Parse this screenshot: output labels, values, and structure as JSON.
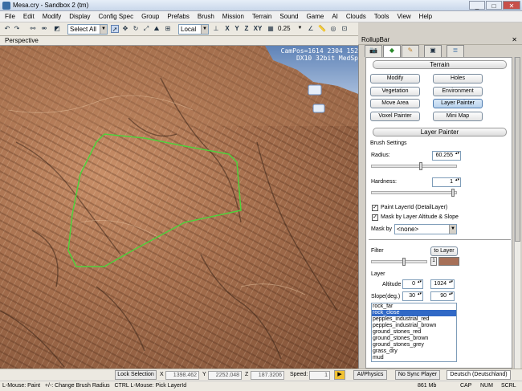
{
  "window": {
    "title": "Mesa.cry - Sandbox 2 (tm)",
    "controls": [
      "_",
      "□",
      "✕"
    ]
  },
  "menu": [
    "File",
    "Edit",
    "Modify",
    "Display",
    "Config Spec",
    "Group",
    "Prefabs",
    "Brush",
    "Mission",
    "Terrain",
    "Sound",
    "Game",
    "AI",
    "Clouds",
    "Tools",
    "View",
    "Help"
  ],
  "toolbar": {
    "selection": "Select All",
    "coord_system": "Local",
    "axes": [
      "X",
      "Y",
      "Z",
      "XY"
    ],
    "snap_value": "0.25"
  },
  "viewport": {
    "label": "Perspective",
    "cam_info": [
      "CamPos=1614 2304 152",
      "DX10 32bit MedSp"
    ]
  },
  "rollup": {
    "title": "RollupBar",
    "close": "✕",
    "tabs": [
      "objects-tab",
      "terrain-tab",
      "modify-tab",
      "display-tab",
      "layers-tab"
    ],
    "terrain_header": "Terrain",
    "terrain_buttons": [
      "Modify",
      "Holes",
      "Vegetation",
      "Environment",
      "Move Area",
      "Layer Painter",
      "Voxel Painter",
      "Mini Map"
    ],
    "active_button": "Layer Painter",
    "lp_header": "Layer Painter",
    "brush_settings": "Brush Settings",
    "radius_label": "Radius:",
    "radius_value": "60.255",
    "radius_fraction": 0.6,
    "hardness_label": "Hardness:",
    "hardness_value": "1",
    "hardness_fraction": 1.0,
    "paint_layerid": "Paint LayerId (DetailLayer)",
    "mask_altitude": "Mask by Layer Altitude & Slope",
    "mask_by_label": "Mask by",
    "mask_by_value": "<none>",
    "filter_label": "Filter",
    "to_layer": "to Layer",
    "filter_value": "1",
    "filter_color": "#a77058",
    "layer_label": "Layer",
    "altitude_label": "Altitude",
    "altitude_min": "0",
    "altitude_max": "1024",
    "slope_label": "Slope(deg.)",
    "slope_min": "30",
    "slope_max": "90",
    "layers": [
      "rock_far",
      "rock_close",
      "pepples_industrial_red",
      "pepples_industrial_brown",
      "ground_stones_red",
      "ground_stones_brown",
      "ground_stones_grey",
      "grass_dry",
      "mud"
    ],
    "selected_layer": "rock_close"
  },
  "status": {
    "lock_selection": "Lock Selection",
    "x_label": "X",
    "x": "1398.462",
    "y_label": "Y",
    "y": "2252.048",
    "z_label": "Z",
    "z": "187.3206",
    "speed_label": "Speed:",
    "speed": "1",
    "ai_physics": "AI/Physics",
    "no_sync": "No Sync Player",
    "language": "Deutsch (Deutschland)",
    "hint": "L-Mouse: Paint   +/-: Change Brush Radius   CTRL L-Mouse: Pick LayerId",
    "memory": "861 Mb",
    "cap": "CAP",
    "num": "NUM",
    "scrl": "SCRL"
  }
}
